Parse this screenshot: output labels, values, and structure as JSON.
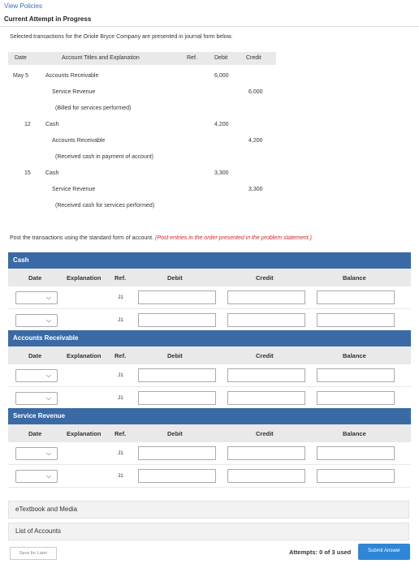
{
  "top": {
    "view_policies": "View Policies",
    "status": "Current Attempt in Progress"
  },
  "problem": {
    "intro": "Selected transactions for the Oriole Bryce Company are presented in journal form below.",
    "headers": {
      "date": "Date",
      "account": "Account Titles and Explanation",
      "ref": "Ref.",
      "debit": "Debit",
      "credit": "Credit"
    },
    "rows": [
      {
        "date": "May 5",
        "account": "Accounts Receivable",
        "debit": "6,000",
        "credit": ""
      },
      {
        "date": "",
        "account": "Service Revenue",
        "debit": "",
        "credit": "6,000"
      },
      {
        "date": "",
        "account": "(Billed for services performed)",
        "debit": "",
        "credit": ""
      },
      {
        "date": "12",
        "account": "Cash",
        "debit": "4,200",
        "credit": ""
      },
      {
        "date": "",
        "account": "Accounts Receivable",
        "debit": "",
        "credit": "4,200"
      },
      {
        "date": "",
        "account": "(Received cash in payment of account)",
        "debit": "",
        "credit": ""
      },
      {
        "date": "15",
        "account": "Cash",
        "debit": "3,300",
        "credit": ""
      },
      {
        "date": "",
        "account": "Service Revenue",
        "debit": "",
        "credit": "3,300"
      },
      {
        "date": "",
        "account": "(Received cash for services performed)",
        "debit": "",
        "credit": ""
      }
    ]
  },
  "instructions": {
    "text": "Post the transactions using the standard form of account.",
    "note": "(Post entries in the order presented in the problem statement.)"
  },
  "ledger_headers": {
    "date": "Date",
    "explanation": "Explanation",
    "ref": "Ref.",
    "debit": "Debit",
    "credit": "Credit",
    "balance": "Balance"
  },
  "accounts": [
    {
      "name": "Cash",
      "refs": [
        "J1",
        "J1"
      ]
    },
    {
      "name": "Accounts Receivable",
      "refs": [
        "J1",
        "J1"
      ]
    },
    {
      "name": "Service Revenue",
      "refs": [
        "J1",
        "J1"
      ]
    }
  ],
  "panels": {
    "etextbook": "eTextbook and Media",
    "list_accounts": "List of Accounts"
  },
  "footer": {
    "save": "Save for Later",
    "attempts": "Attempts: 0 of 3 used",
    "submit": "Submit Answer"
  },
  "colors": {
    "account_bar": "#3a6aa5",
    "submit": "#2f86d6",
    "note": "#d9232d"
  }
}
